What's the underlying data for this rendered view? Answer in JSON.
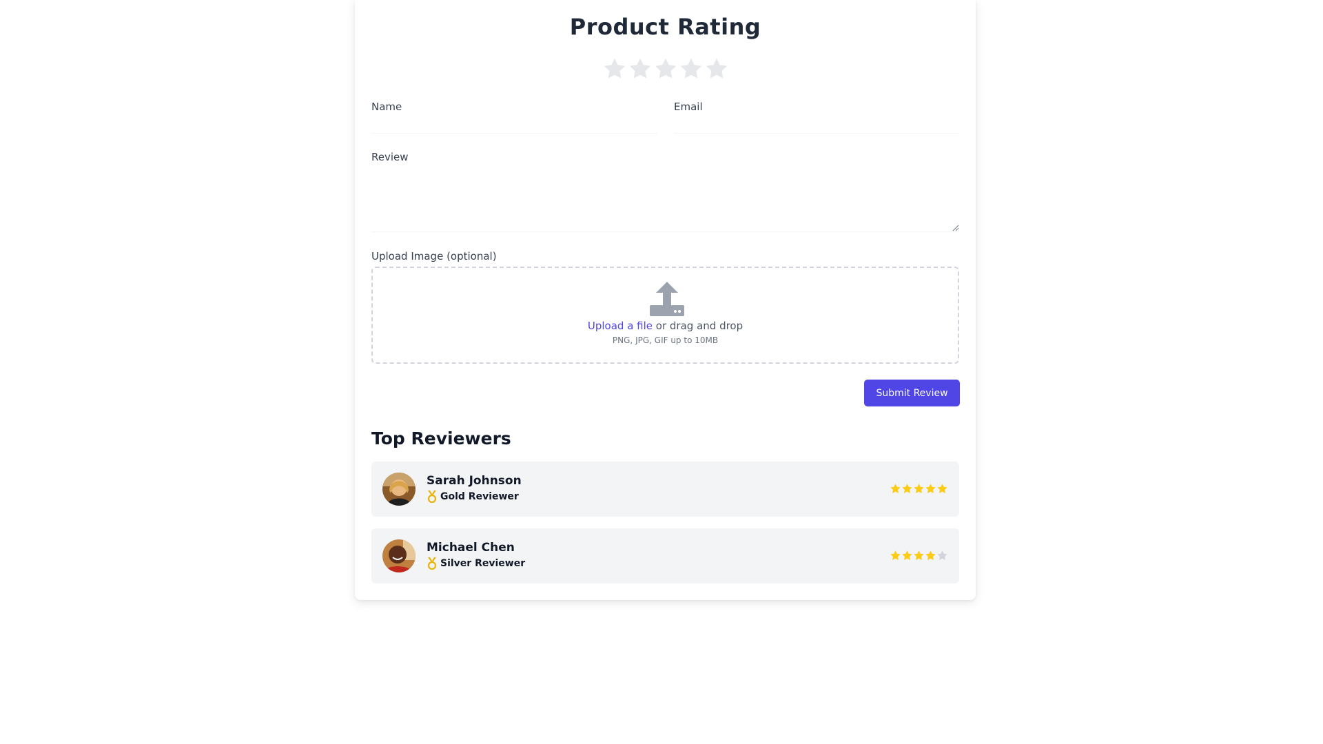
{
  "form": {
    "title": "Product Rating",
    "rating": {
      "value": 0,
      "max": 5
    },
    "name_label": "Name",
    "name_value": "",
    "email_label": "Email",
    "email_value": "",
    "review_label": "Review",
    "review_value": "",
    "upload_label": "Upload Image (optional)",
    "upload_link": "Upload a file",
    "upload_text": "or drag and drop",
    "upload_hint": "PNG, JPG, GIF up to 10MB",
    "submit_label": "Submit Review"
  },
  "top_reviewers": {
    "title": "Top Reviewers",
    "items": [
      {
        "name": "Sarah Johnson",
        "badge": "Gold Reviewer",
        "badge_icon": "medal-icon",
        "rating": 5
      },
      {
        "name": "Michael Chen",
        "badge": "Silver Reviewer",
        "badge_icon": "medal-icon",
        "rating": 4
      }
    ]
  },
  "colors": {
    "accent": "#4f46e5",
    "star_filled": "#facc15",
    "star_empty": "#d1d5db",
    "star_unrated": "#e5e7eb",
    "medal": "#eab308"
  }
}
